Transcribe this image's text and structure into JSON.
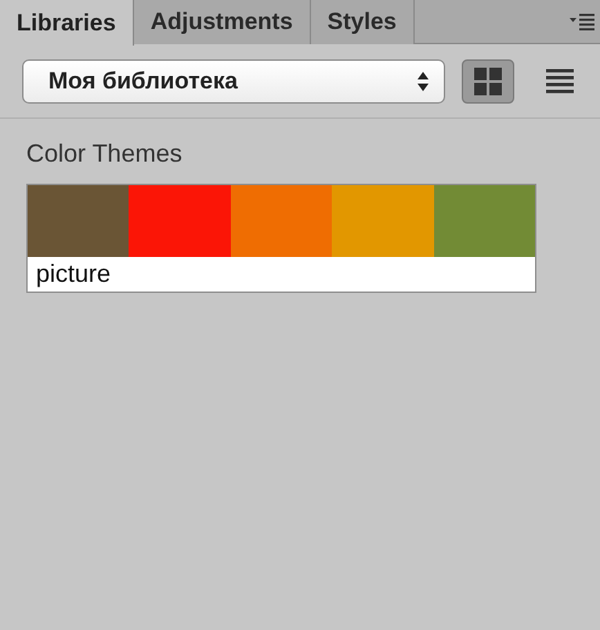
{
  "tabs": [
    {
      "label": "Libraries",
      "selected": true
    },
    {
      "label": "Adjustments",
      "selected": false
    },
    {
      "label": "Styles",
      "selected": false
    }
  ],
  "library_select": {
    "value": "Моя библиотека"
  },
  "view_buttons": [
    {
      "kind": "grid",
      "selected": true
    },
    {
      "kind": "list",
      "selected": false
    }
  ],
  "section": {
    "title": "Color Themes",
    "themes": [
      {
        "name": "picture",
        "swatches": [
          {
            "color": "#6a5535"
          },
          {
            "color": "#fb1506"
          },
          {
            "color": "#ef6d02"
          },
          {
            "color": "#e29700"
          },
          {
            "color": "#728b35"
          }
        ]
      }
    ]
  }
}
